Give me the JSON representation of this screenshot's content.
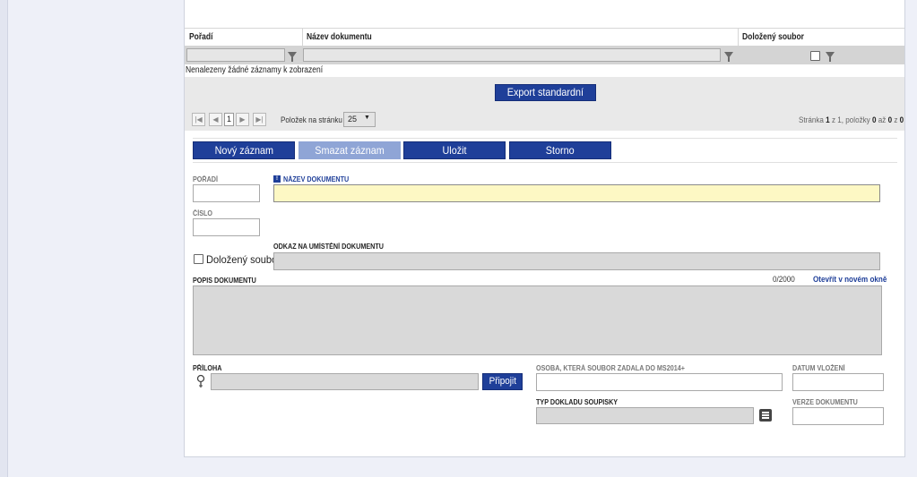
{
  "grid": {
    "headers": {
      "order": "Pořadí",
      "doc_name": "Název dokumentu",
      "attached": "Doložený soubor"
    },
    "no_records": "Nenalezeny žádné záznamy k zobrazení",
    "export_label": "Export standardní",
    "pager": {
      "current_page": "1",
      "per_page_label": "Položek na stránku",
      "per_page_value": "25",
      "status": {
        "prefix": "Stránka ",
        "page": "1",
        "of": " z ",
        "pages": "1",
        "items": ", položky ",
        "from": "0",
        "to_word": " až ",
        "to": "0",
        "z": " z ",
        "total": "0"
      }
    }
  },
  "toolbar": {
    "new": "Nový záznam",
    "delete": "Smazat záznam",
    "save": "Uložit",
    "cancel": "Storno"
  },
  "form": {
    "order_label": "Pořadí",
    "doc_name_label": "Název dokumentu",
    "number_label": "Číslo",
    "attached_label": "Doložený soubor",
    "link_label": "Odkaz na umístění dokumentu",
    "desc_label": "Popis dokumentu",
    "char_count": "0/2000",
    "open_new_window": "Otevřít v novém okně",
    "attachment_label": "Příloha",
    "attach_button": "Připojit",
    "person_label": "Osoba, která soubor zadala do MS2014+",
    "date_label": "Datum vložení",
    "receipt_type_label": "Typ dokladu soupisky",
    "version_label": "Verze dokumentu"
  },
  "colors": {
    "primary": "#1f3f99",
    "required": "#fdf8c4",
    "link": "#1f3f99"
  },
  "icons": {
    "filter": "filter-icon",
    "first": "first-page-icon",
    "prev": "prev-page-icon",
    "next": "next-page-icon",
    "last": "last-page-icon",
    "dropdown": "chevron-down-icon",
    "required": "required-icon",
    "pin": "pin-icon",
    "list": "list-icon"
  }
}
